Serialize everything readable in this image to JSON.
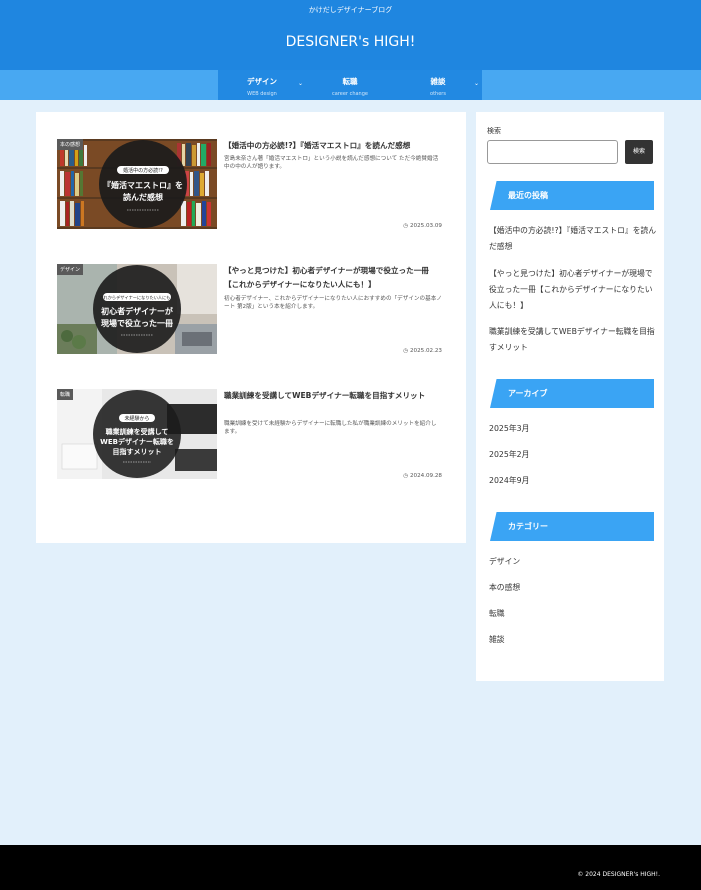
{
  "header": {
    "tagline": "かけだしデザイナーブログ",
    "site_title": "DESIGNER's HIGH!",
    "colors": {
      "header": "#1f86e0",
      "nav": "#2289e2",
      "nav_band": "#48a8f2",
      "background": "#e2f0fb",
      "widget_title": "#3aa4f4"
    }
  },
  "nav": {
    "items": [
      {
        "label": "デザイン",
        "sub": "WEB design",
        "icon": "chevron-down-icon"
      },
      {
        "label": "転職",
        "sub": "career change"
      },
      {
        "label": "雑談",
        "sub": "others",
        "icon": "chevron-down-icon"
      }
    ]
  },
  "posts": [
    {
      "category": "本の感想",
      "title": "【婚活中の方必読!?】『婚活マエストロ』を読んだ感想",
      "excerpt": "宮島未奈さん著「婚活マエストロ」という小説を読んだ感想について ただ今絶賛婚活中の中の人が語ります。",
      "date": "2025.03.09",
      "thumb_small": "婚活中の方必読!?",
      "thumb_line1": "『婚活マエストロ』を",
      "thumb_line2": "読んだ感想"
    },
    {
      "category": "デザイン",
      "title": "【やっと見つけた】初心者デザイナーが現場で役立った一冊【これからデザイナーになりたい人にも！】",
      "excerpt": "初心者デザイナー、これからデザイナーになりたい人におすすめの「デザインの基本ノート 第2版」という本を紹介します。",
      "date": "2025.02.23",
      "thumb_small": "これからデザイナーになりたい人にも！",
      "thumb_line1": "初心者デザイナーが",
      "thumb_line2": "現場で役立った一冊"
    },
    {
      "category": "転職",
      "title": "職業訓練を受講してWEBデザイナー転職を目指すメリット",
      "excerpt": "職業訓練を受けて未経験からデザイナーに転職した私が職業訓練のメリットを紹介します。",
      "date": "2024.09.28",
      "thumb_small": "未経験から",
      "thumb_line1": "職業訓練を受講して",
      "thumb_line2": "WEBデザイナー転職を",
      "thumb_line3": "目指すメリット"
    }
  ],
  "sidebar": {
    "search_label": "検索",
    "search_placeholder": "",
    "search_button": "検索",
    "recent_title": "最近の投稿",
    "recent": [
      "【婚活中の方必読!?】『婚活マエストロ』を読んだ感想",
      "【やっと見つけた】初心者デザイナーが現場で役立った一冊【これからデザイナーになりたい人にも！】",
      "職業訓練を受講してWEBデザイナー転職を目指すメリット"
    ],
    "archive_title": "アーカイブ",
    "archives": [
      "2025年3月",
      "2025年2月",
      "2024年9月"
    ],
    "category_title": "カテゴリー",
    "categories": [
      "デザイン",
      "本の感想",
      "転職",
      "雑談"
    ]
  },
  "footer": {
    "copyright": "© 2024 DESIGNER's HIGH!."
  }
}
